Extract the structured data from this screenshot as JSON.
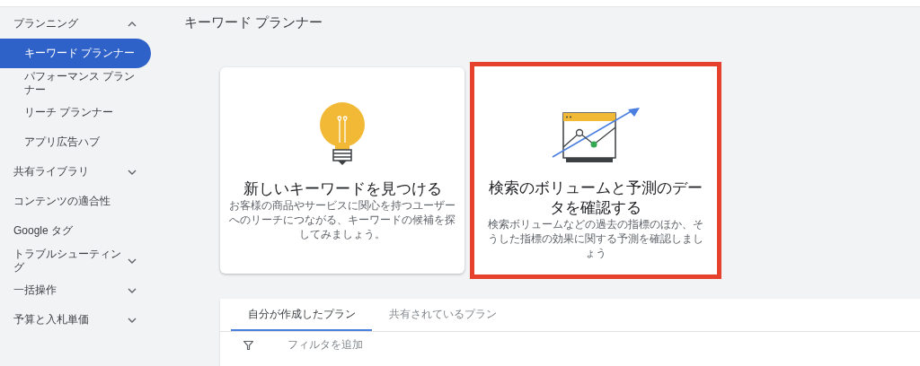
{
  "sidebar": {
    "items": [
      {
        "label": "プランニング",
        "kind": "group",
        "expanded": true,
        "children": [
          {
            "label": "キーワード プランナー",
            "selected": true
          },
          {
            "label": "パフォーマンス プランナー",
            "selected": false
          },
          {
            "label": "リーチ プランナー",
            "selected": false
          },
          {
            "label": "アプリ広告ハブ",
            "selected": false
          }
        ]
      },
      {
        "label": "共有ライブラリ",
        "kind": "group",
        "expanded": false
      },
      {
        "label": "コンテンツの適合性",
        "kind": "link"
      },
      {
        "label": "Google タグ",
        "kind": "link"
      },
      {
        "label": "トラブルシューティング",
        "kind": "group",
        "expanded": false
      },
      {
        "label": "一括操作",
        "kind": "group",
        "expanded": false
      },
      {
        "label": "予算と入札単価",
        "kind": "group",
        "expanded": false
      }
    ]
  },
  "page": {
    "title": "キーワード プランナー"
  },
  "cards": [
    {
      "kind": "idea",
      "title": "新しいキーワードを見つける",
      "description": "お客様の商品やサービスに関心を持つユーザーへのリーチにつながる、キーワードの候補を探してみましょう。",
      "selected": false
    },
    {
      "kind": "forecast",
      "title": "検索のボリュームと予測のデータを確認する",
      "description": "検索ボリュームなどの過去の指標のほか、そうした指標の効果に関する予測を確認しましょう",
      "selected": true
    }
  ],
  "plans": {
    "tabs": [
      {
        "label": "自分が作成したプラン",
        "selected": true
      },
      {
        "label": "共有されているプラン",
        "selected": false
      }
    ],
    "filter": {
      "label": "フィルタを追加"
    }
  }
}
